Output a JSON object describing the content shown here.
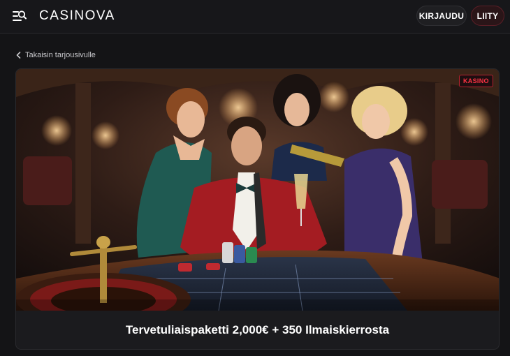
{
  "header": {
    "logo_text": "CASINOVA",
    "login_label": "KIRJAUDU",
    "join_label": "LIITY",
    "menu_icon": "menu-search-icon"
  },
  "nav": {
    "back_label": "Takaisin tarjousivulle",
    "back_icon": "chevron-left-icon"
  },
  "offer": {
    "badge": "KASINO",
    "title": "Tervetuliaispaketti 2,000€ + 350 Ilmaiskierrosta",
    "image_subject": "casino-roulette-scene"
  },
  "colors": {
    "background": "#141416",
    "accent_red": "#e0202f",
    "text": "#ffffff"
  }
}
